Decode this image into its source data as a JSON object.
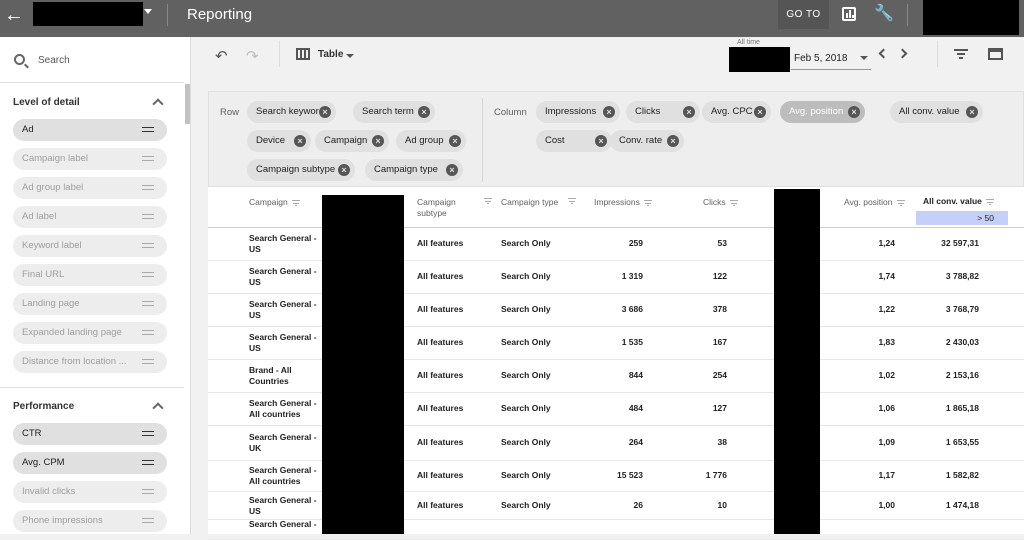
{
  "topbar": {
    "title": "Reporting",
    "goto_label": "GO TO",
    "icons": [
      "back-arrow-icon",
      "bar-chart-icon",
      "wrench-icon"
    ]
  },
  "sidebar": {
    "search_placeholder": "Search",
    "section_detail": "Level of detail",
    "detail_items": [
      {
        "label": "Ad",
        "active": true
      },
      {
        "label": "Campaign label",
        "active": false
      },
      {
        "label": "Ad group label",
        "active": false
      },
      {
        "label": "Ad label",
        "active": false
      },
      {
        "label": "Keyword label",
        "active": false
      },
      {
        "label": "Final URL",
        "active": false
      },
      {
        "label": "Landing page",
        "active": false
      },
      {
        "label": "Expanded landing page",
        "active": false
      },
      {
        "label": "Distance from location ...",
        "active": false
      }
    ],
    "section_performance": "Performance",
    "performance_items": [
      {
        "label": "CTR",
        "active": true
      },
      {
        "label": "Avg. CPM",
        "active": true
      },
      {
        "label": "Invalid clicks",
        "active": false
      },
      {
        "label": "Phone impressions",
        "active": false
      }
    ]
  },
  "toolbar": {
    "view_label": "Table",
    "date_caption": "All time",
    "date_value": "Feb 5, 2018"
  },
  "config": {
    "row_label": "Row",
    "column_label": "Column",
    "row_chips": [
      "Search keyword",
      "Search term",
      "Device",
      "Campaign",
      "Ad group",
      "Campaign subtype",
      "Campaign type"
    ],
    "column_chips": [
      "Impressions",
      "Clicks",
      "Avg. CPC",
      "Avg. position",
      "All conv. value",
      "Cost",
      "Conv. rate"
    ]
  },
  "table": {
    "headers": {
      "campaign": "Campaign",
      "subtype": "Campaign subtype",
      "type": "Campaign type",
      "impressions": "Impressions",
      "clicks": "Clicks",
      "avg_position": "Avg. position",
      "all_conv_value": "All conv. value"
    },
    "filter": "> 50",
    "rows": [
      {
        "campaign": "Search General - US",
        "subtype": "All features",
        "type": "Search Only",
        "impressions": "259",
        "clicks": "53",
        "avg_position": "1,24",
        "conv": "32 597,31"
      },
      {
        "campaign": "Search General - US",
        "subtype": "All features",
        "type": "Search Only",
        "impressions": "1 319",
        "clicks": "122",
        "avg_position": "1,74",
        "conv": "3 788,82"
      },
      {
        "campaign": "Search General - US",
        "subtype": "All features",
        "type": "Search Only",
        "impressions": "3 686",
        "clicks": "378",
        "avg_position": "1,22",
        "conv": "3 768,79"
      },
      {
        "campaign": "Search General - US",
        "subtype": "All features",
        "type": "Search Only",
        "impressions": "1 535",
        "clicks": "167",
        "avg_position": "1,83",
        "conv": "2 430,03"
      },
      {
        "campaign": "Brand - All Countries",
        "subtype": "All features",
        "type": "Search Only",
        "impressions": "844",
        "clicks": "254",
        "avg_position": "1,02",
        "conv": "2 153,16"
      },
      {
        "campaign": "Search General - All countries",
        "subtype": "All features",
        "type": "Search Only",
        "impressions": "484",
        "clicks": "127",
        "avg_position": "1,06",
        "conv": "1 865,18"
      },
      {
        "campaign": "Search General - UK",
        "subtype": "All features",
        "type": "Search Only",
        "impressions": "264",
        "clicks": "38",
        "avg_position": "1,09",
        "conv": "1 653,55"
      },
      {
        "campaign": "Search General - All countries",
        "subtype": "All features",
        "type": "Search Only",
        "impressions": "15 523",
        "clicks": "1 776",
        "avg_position": "1,17",
        "conv": "1 582,82"
      },
      {
        "campaign": "Search General - US",
        "subtype": "All features",
        "type": "Search Only",
        "impressions": "26",
        "clicks": "10",
        "avg_position": "1,00",
        "conv": "1 474,18"
      },
      {
        "campaign": "Search General -",
        "subtype": "",
        "type": "",
        "impressions": "",
        "clicks": "",
        "avg_position": "",
        "conv": ""
      }
    ]
  }
}
